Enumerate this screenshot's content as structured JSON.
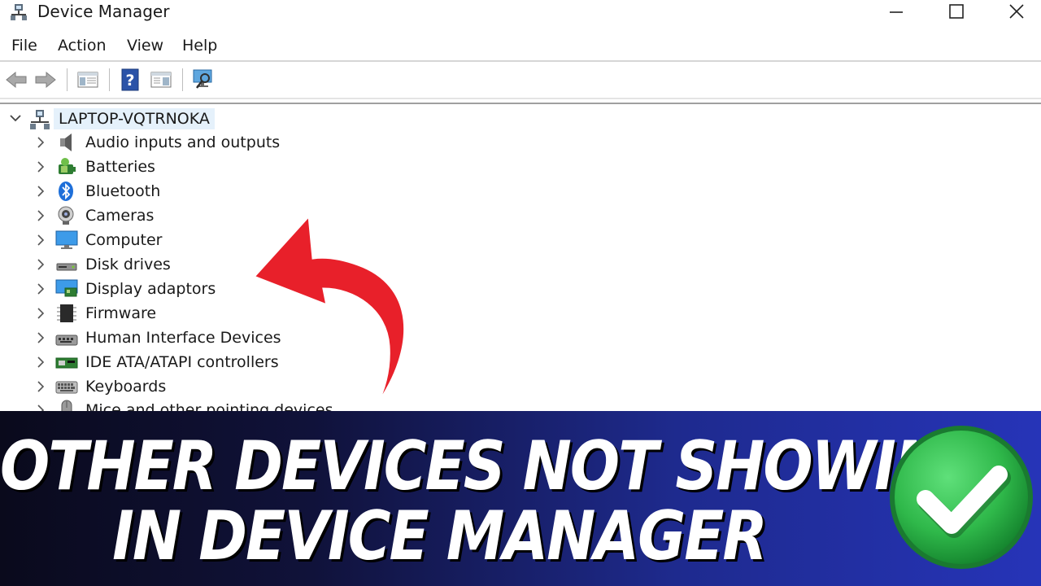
{
  "window": {
    "title": "Device Manager"
  },
  "menu": {
    "file": "File",
    "action": "Action",
    "view": "View",
    "help": "Help"
  },
  "tree": {
    "root_label": "LAPTOP-VQTRNOKA",
    "items": [
      {
        "label": "Audio inputs and outputs",
        "icon": "speaker-icon"
      },
      {
        "label": "Batteries",
        "icon": "battery-icon"
      },
      {
        "label": "Bluetooth",
        "icon": "bluetooth-icon"
      },
      {
        "label": "Cameras",
        "icon": "camera-icon"
      },
      {
        "label": "Computer",
        "icon": "monitor-icon"
      },
      {
        "label": "Disk drives",
        "icon": "disk-drive-icon"
      },
      {
        "label": "Display adaptors",
        "icon": "display-adapter-icon"
      },
      {
        "label": "Firmware",
        "icon": "firmware-icon"
      },
      {
        "label": "Human Interface Devices",
        "icon": "hid-icon"
      },
      {
        "label": "IDE ATA/ATAPI controllers",
        "icon": "ide-controller-icon"
      },
      {
        "label": "Keyboards",
        "icon": "keyboard-icon"
      },
      {
        "label": "Mice and other pointing devices",
        "icon": "mouse-icon"
      }
    ]
  },
  "banner": {
    "line1": "OTHER DEVICES NOT SHOWING",
    "line2": "IN DEVICE MANAGER"
  },
  "colors": {
    "arrow": "#e8202a",
    "check_badge": "#2fb84a",
    "selection": "#e5f1fb",
    "banner_dark": "#0a0a1c",
    "banner_blue": "#2634b8"
  }
}
